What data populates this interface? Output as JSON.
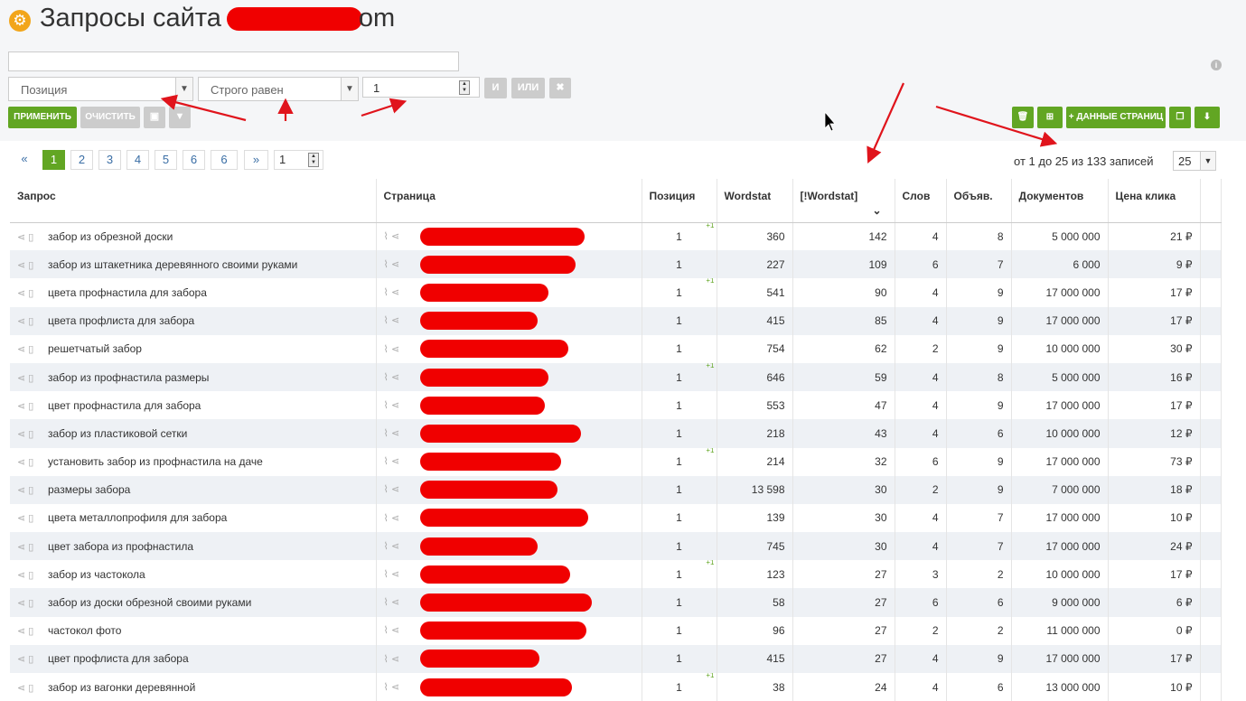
{
  "header": {
    "title": "Запросы сайта",
    "title_tail": "om"
  },
  "filters": {
    "search_value": "",
    "field_select": "Позиция",
    "condition_select": "Строго равен",
    "value": "1",
    "and_label": "И",
    "or_label": "ИЛИ",
    "remove_label": "✖",
    "apply_label": "ПРИМЕНИТЬ",
    "clear_label": "ОЧИСТИТЬ"
  },
  "toolbar": {
    "page_data_label": "+ ДАННЫЕ СТРАНИЦ"
  },
  "pagination": {
    "prev": "«",
    "next": "»",
    "pages": [
      "1",
      "2",
      "3",
      "4",
      "5",
      "6",
      "6"
    ],
    "goto_value": "1",
    "records_text": "от 1 до 25 из 133 записей",
    "per_page": "25"
  },
  "columns": [
    "Запрос",
    "Страница",
    "Позиция",
    "Wordstat",
    "[!Wordstat]",
    "Слов",
    "Объяв.",
    "Документов",
    "Цена клика"
  ],
  "rows": [
    {
      "query": "забор из обрезной доски",
      "pos": "1",
      "ws": "360",
      "ws_exact": "142",
      "words": "4",
      "ads": "8",
      "docs": "5 000 000",
      "price": "21 ₽"
    },
    {
      "query": "забор из штакетника деревянного своими руками",
      "pos": "1",
      "ws": "227",
      "ws_exact": "109",
      "words": "6",
      "ads": "7",
      "docs": "6 000",
      "price": "9 ₽"
    },
    {
      "query": "цвета профнастила для забора",
      "pos": "1",
      "ws": "541",
      "ws_exact": "90",
      "words": "4",
      "ads": "9",
      "docs": "17 000 000",
      "price": "17 ₽"
    },
    {
      "query": "цвета профлиста для забора",
      "pos": "1",
      "ws": "415",
      "ws_exact": "85",
      "words": "4",
      "ads": "9",
      "docs": "17 000 000",
      "price": "17 ₽"
    },
    {
      "query": "решетчатый забор",
      "pos": "1",
      "ws": "754",
      "ws_exact": "62",
      "words": "2",
      "ads": "9",
      "docs": "10 000 000",
      "price": "30 ₽"
    },
    {
      "query": "забор из профнастила размеры",
      "pos": "1",
      "ws": "646",
      "ws_exact": "59",
      "words": "4",
      "ads": "8",
      "docs": "5 000 000",
      "price": "16 ₽"
    },
    {
      "query": "цвет профнастила для забора",
      "pos": "1",
      "ws": "553",
      "ws_exact": "47",
      "words": "4",
      "ads": "9",
      "docs": "17 000 000",
      "price": "17 ₽"
    },
    {
      "query": "забор из пластиковой сетки",
      "pos": "1",
      "ws": "218",
      "ws_exact": "43",
      "words": "4",
      "ads": "6",
      "docs": "10 000 000",
      "price": "12 ₽"
    },
    {
      "query": "установить забор из профнастила на даче",
      "pos": "1",
      "ws": "214",
      "ws_exact": "32",
      "words": "6",
      "ads": "9",
      "docs": "17 000 000",
      "price": "73 ₽"
    },
    {
      "query": "размеры забора",
      "pos": "1",
      "ws": "13 598",
      "ws_exact": "30",
      "words": "2",
      "ads": "9",
      "docs": "7 000 000",
      "price": "18 ₽"
    },
    {
      "query": "цвета металлопрофиля для забора",
      "pos": "1",
      "ws": "139",
      "ws_exact": "30",
      "words": "4",
      "ads": "7",
      "docs": "17 000 000",
      "price": "10 ₽"
    },
    {
      "query": "цвет забора из профнастила",
      "pos": "1",
      "ws": "745",
      "ws_exact": "30",
      "words": "4",
      "ads": "7",
      "docs": "17 000 000",
      "price": "24 ₽"
    },
    {
      "query": "забор из частокола",
      "pos": "1",
      "ws": "123",
      "ws_exact": "27",
      "words": "3",
      "ads": "2",
      "docs": "10 000 000",
      "price": "17 ₽"
    },
    {
      "query": "забор из доски обрезной своими руками",
      "pos": "1",
      "ws": "58",
      "ws_exact": "27",
      "words": "6",
      "ads": "6",
      "docs": "9 000 000",
      "price": "6 ₽"
    },
    {
      "query": "частокол фото",
      "pos": "1",
      "ws": "96",
      "ws_exact": "27",
      "words": "2",
      "ads": "2",
      "docs": "11 000 000",
      "price": "0 ₽"
    },
    {
      "query": "цвет профлиста для забора",
      "pos": "1",
      "ws": "415",
      "ws_exact": "27",
      "words": "4",
      "ads": "9",
      "docs": "17 000 000",
      "price": "17 ₽"
    },
    {
      "query": "забор из вагонки деревянной",
      "pos": "1",
      "ws": "38",
      "ws_exact": "24",
      "words": "4",
      "ads": "6",
      "docs": "13 000 000",
      "price": "10 ₽"
    }
  ],
  "row_change_badge": "+1",
  "icons": [
    "gear-icon",
    "info-icon",
    "share-icon",
    "document-icon",
    "paperclip-icon",
    "trash-icon",
    "sitemap-icon",
    "copy-icon",
    "download-icon",
    "save-icon",
    "filter-icon",
    "sort-desc-icon"
  ],
  "colors": {
    "accent_green": "#62a623",
    "gear_orange": "#f2a51a",
    "redaction": "#f00000",
    "annotation_arrow": "#e0141c"
  }
}
